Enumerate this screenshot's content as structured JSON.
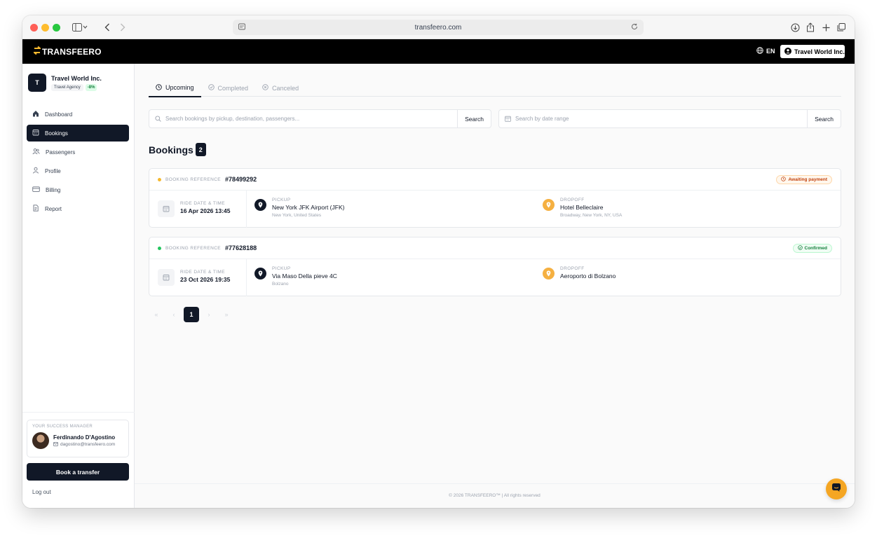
{
  "browser": {
    "url": "transfeero.com"
  },
  "header": {
    "brand": "TRANSFEERO",
    "language": "EN",
    "account_label": "Travel World Inc."
  },
  "sidebar": {
    "org": {
      "initial": "T",
      "name": "Travel World Inc.",
      "type": "Travel Agency",
      "discount": "-8%"
    },
    "items": [
      {
        "label": "Dashboard",
        "icon": "home-icon",
        "active": false
      },
      {
        "label": "Bookings",
        "icon": "calendar-icon",
        "active": true
      },
      {
        "label": "Passengers",
        "icon": "users-icon",
        "active": false
      },
      {
        "label": "Profile",
        "icon": "user-icon",
        "active": false
      },
      {
        "label": "Billing",
        "icon": "credit-card-icon",
        "active": false
      },
      {
        "label": "Report",
        "icon": "document-icon",
        "active": false
      }
    ],
    "manager": {
      "title": "YOUR SUCCESS MANAGER",
      "name": "Ferdinando D'Agostino",
      "email": "dagostino@transfeero.com"
    },
    "book_button": "Book a transfer",
    "logout": "Log out"
  },
  "main": {
    "tabs": [
      {
        "label": "Upcoming",
        "active": true
      },
      {
        "label": "Completed",
        "active": false
      },
      {
        "label": "Canceled",
        "active": false
      }
    ],
    "search": {
      "placeholder": "Search bookings by pickup, destination, passengers...",
      "button": "Search"
    },
    "date_search": {
      "placeholder": "Search by date range",
      "button": "Search"
    },
    "title": "Bookings",
    "count": "2",
    "labels": {
      "booking_reference": "BOOKING REFERENCE",
      "ride_date_time": "RIDE DATE & TIME",
      "pickup": "PICKUP",
      "dropoff": "DROPOFF"
    },
    "bookings": [
      {
        "reference": "#78499292",
        "status": "Awaiting payment",
        "status_color": "#f59e0b",
        "datetime": "16 Apr 2026 13:45",
        "pickup": {
          "name": "New York JFK Airport (JFK)",
          "sub": "New York, United States"
        },
        "dropoff": {
          "name": "Hotel Belleclaire",
          "sub": "Broadway, New York, NY, USA"
        }
      },
      {
        "reference": "#77628188",
        "status": "Confirmed",
        "status_color": "#22c55e",
        "datetime": "23 Oct 2026 19:35",
        "pickup": {
          "name": "Via Maso Della pieve 4C",
          "sub": "Bolzano"
        },
        "dropoff": {
          "name": "Aeroporto di Bolzano",
          "sub": ""
        }
      }
    ],
    "pagination": {
      "first": "«",
      "prev": "‹",
      "current": "1",
      "next": "›",
      "last": "»"
    }
  },
  "footer": {
    "text": "© 2026 TRANSFEERO™ | All rights reserved"
  },
  "colors": {
    "brand_dark": "#111827",
    "accent": "#f5b041"
  }
}
